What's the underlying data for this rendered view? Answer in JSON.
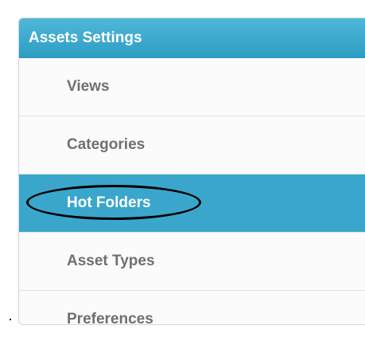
{
  "panel": {
    "title": "Assets Settings",
    "header_color": "#3aa8cf"
  },
  "menu": {
    "items": [
      {
        "label": "Views",
        "active": false
      },
      {
        "label": "Categories",
        "active": false
      },
      {
        "label": "Hot Folders",
        "active": true
      },
      {
        "label": "Asset Types",
        "active": false
      },
      {
        "label": "Preferences",
        "active": false
      }
    ]
  },
  "colors": {
    "active_bg": "#3aa6cc",
    "item_text": "#707070",
    "annotation": "#000000"
  }
}
